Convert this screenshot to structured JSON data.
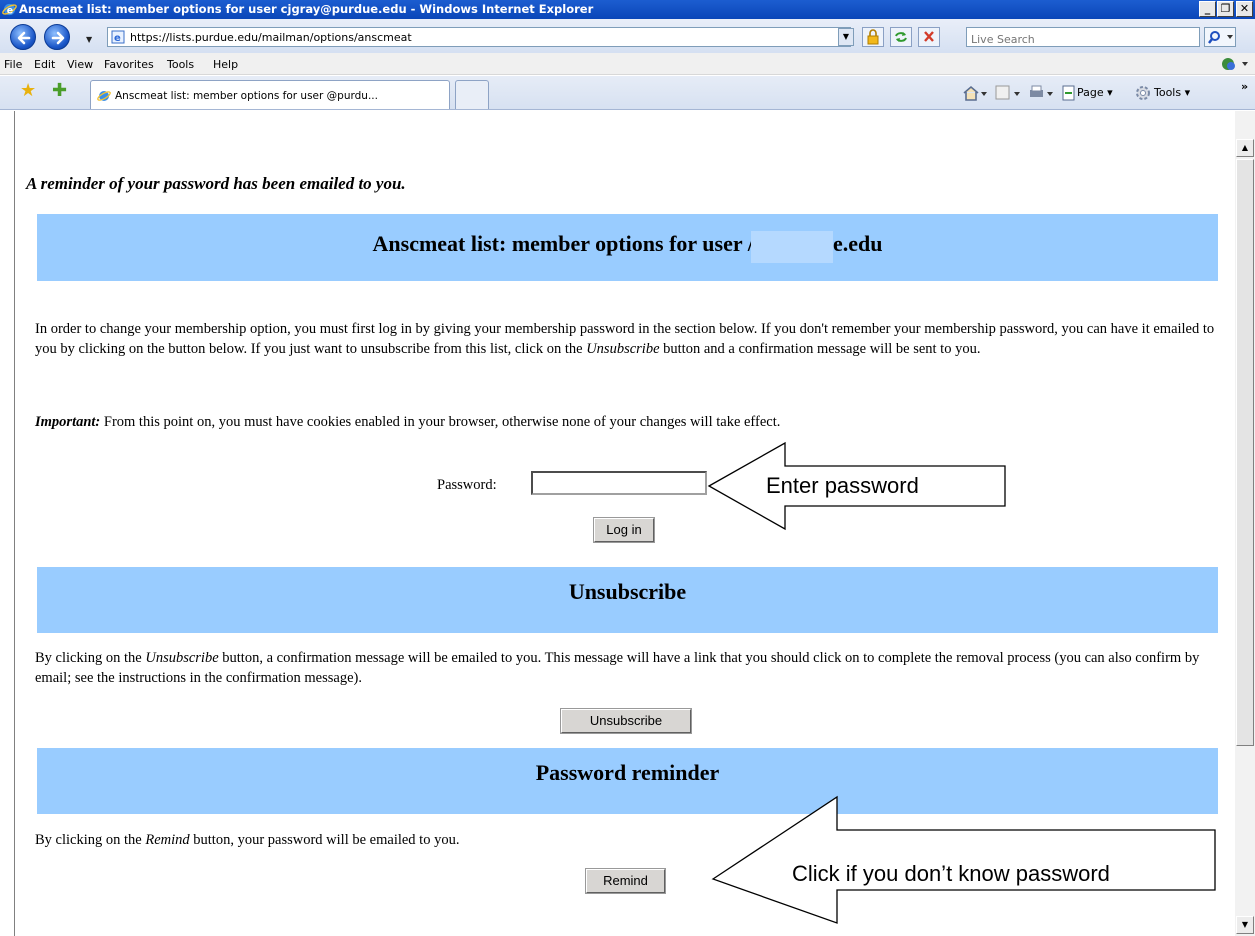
{
  "window": {
    "title": "Anscmeat list: member options for user cjgray@purdue.edu - Windows Internet Explorer",
    "controls": [
      "_",
      "࿭eral",
      "X"
    ]
  },
  "address_bar": {
    "url": "https://lists.purdue.edu/mailman/options/anscmeat",
    "search_placeholder": "Live Search"
  },
  "menu": {
    "items": [
      "File",
      "Edit",
      "View",
      "Favorites",
      "Tools",
      "Help"
    ]
  },
  "tabs": {
    "active_label": "Anscmeat list: member options for user          @purdu..."
  },
  "command_bar": {
    "page_label": "Page",
    "tools_label": "Tools"
  },
  "page": {
    "reminder_message": "A reminder of your password has been emailed to you.",
    "header_title": "Anscmeat list: member options for user         /@purdue.edu",
    "intro_paragraph_1": "In order to change your membership option, you must first log in by giving your membership password in the section below. If you don't remember your membership password, you can have it emailed to you by clicking on the button below. If you just want to unsubscribe from this list, click on the",
    "intro_unsubscribe_word": "Unsubscribe",
    "intro_paragraph_1_end": "button and a confirmation message will be sent to you.",
    "important_label": "Important:",
    "important_text": "From this point on, you must have cookies enabled in your browser, otherwise none of your changes will take effect.",
    "password_label": "Password:",
    "password_value": "",
    "login_button": "Log in",
    "unsubscribe_section": {
      "title": "Unsubscribe",
      "text_before": "By clicking on the",
      "text_italic": "Unsubscribe",
      "text_after": "button, a confirmation message will be emailed to you. This message will have a link that you should click on to complete the removal process (you can also confirm by email; see the instructions in the confirmation message).",
      "button": "Unsubscribe"
    },
    "reminder_section": {
      "title": "Password reminder",
      "text_before": "By clicking on the",
      "text_italic": "Remind",
      "text_after": "button, your password will be emailed to you.",
      "button": "Remind"
    }
  },
  "annotations": {
    "password_callout": "Enter password",
    "remind_callout": "Click if you don’t know password"
  },
  "colors": {
    "section_band": "#99ccff",
    "titlebar": "#0a46b8"
  }
}
